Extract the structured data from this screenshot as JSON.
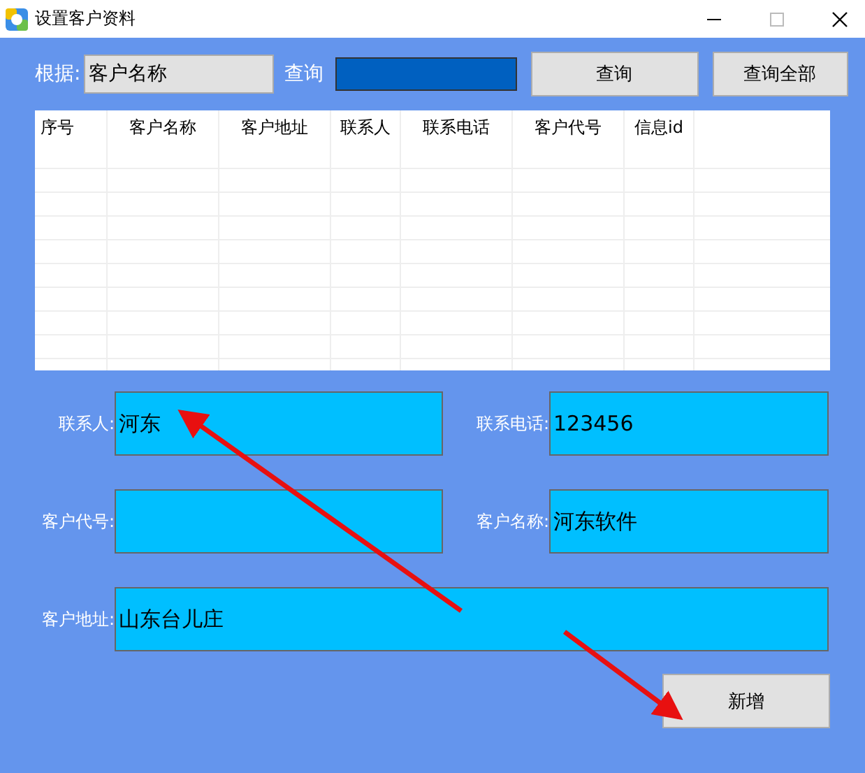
{
  "window": {
    "title": "设置客户资料"
  },
  "search": {
    "by_label": "根据:",
    "by_value": "客户名称",
    "query_label": "查询",
    "buttons": [
      "查询",
      "查询全部"
    ]
  },
  "table": {
    "columns": [
      "序号",
      "客户名称",
      "客户地址",
      "联系人",
      "联系电话",
      "客户代号",
      "信息id"
    ]
  },
  "form": {
    "rows": [
      [
        {
          "label": "联系人:",
          "value": "河东"
        },
        {
          "label": "联系电话:",
          "value": "123456"
        }
      ],
      [
        {
          "label": "客户代号:"
        },
        {
          "label": "客户名称:",
          "value": "河东软件"
        }
      ],
      [
        {
          "label": "客户地址:",
          "value": "山东台儿庄"
        }
      ]
    ],
    "button": "新增"
  }
}
